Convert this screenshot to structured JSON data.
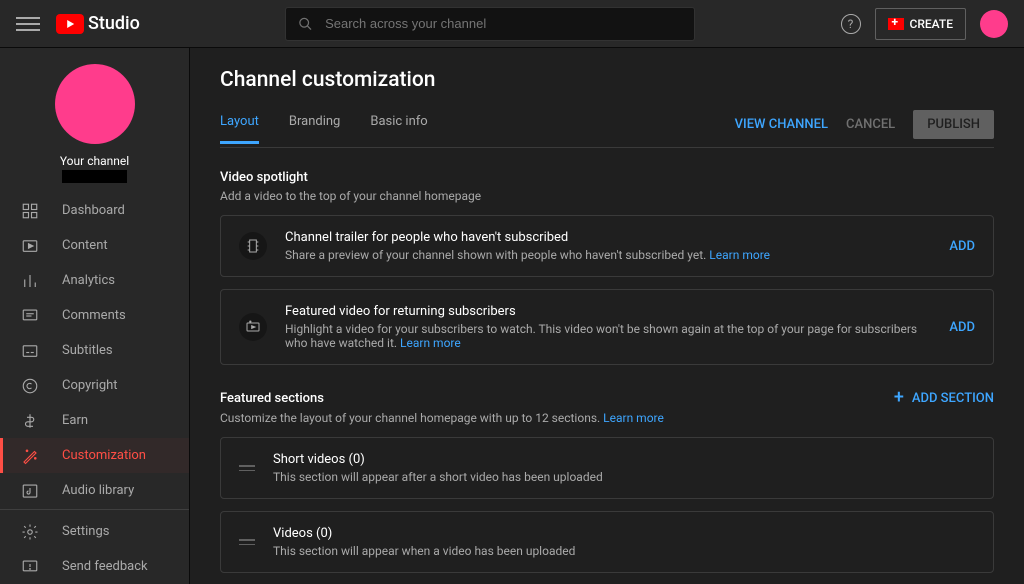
{
  "header": {
    "logo_text": "Studio",
    "search_placeholder": "Search across your channel",
    "create_label": "CREATE"
  },
  "sidebar": {
    "channel_name": "Your channel",
    "items": [
      {
        "label": "Dashboard"
      },
      {
        "label": "Content"
      },
      {
        "label": "Analytics"
      },
      {
        "label": "Comments"
      },
      {
        "label": "Subtitles"
      },
      {
        "label": "Copyright"
      },
      {
        "label": "Earn"
      },
      {
        "label": "Customization"
      },
      {
        "label": "Audio library"
      }
    ],
    "footer": [
      {
        "label": "Settings"
      },
      {
        "label": "Send feedback"
      }
    ]
  },
  "page": {
    "title": "Channel customization",
    "tabs": [
      {
        "label": "Layout"
      },
      {
        "label": "Branding"
      },
      {
        "label": "Basic info"
      }
    ],
    "actions": {
      "view": "VIEW CHANNEL",
      "cancel": "CANCEL",
      "publish": "PUBLISH"
    }
  },
  "spotlight": {
    "title": "Video spotlight",
    "subtitle": "Add a video to the top of your channel homepage",
    "cards": [
      {
        "title": "Channel trailer for people who haven't subscribed",
        "desc": "Share a preview of your channel shown with people who haven't subscribed yet.  ",
        "learn": "Learn more",
        "action": "ADD"
      },
      {
        "title": "Featured video for returning subscribers",
        "desc": "Highlight a video for your subscribers to watch. This video won't be shown again at the top of your page for subscribers who have watched it.  ",
        "learn": "Learn more",
        "action": "ADD"
      }
    ]
  },
  "featured": {
    "title": "Featured sections",
    "subtitle": "Customize the layout of your channel homepage with up to 12 sections. ",
    "learn": "Learn more",
    "add_btn": "ADD SECTION",
    "cards": [
      {
        "title": "Short videos (0)",
        "desc": "This section will appear after a short video has been uploaded"
      },
      {
        "title": "Videos (0)",
        "desc": "This section will appear when a video has been uploaded"
      }
    ]
  }
}
